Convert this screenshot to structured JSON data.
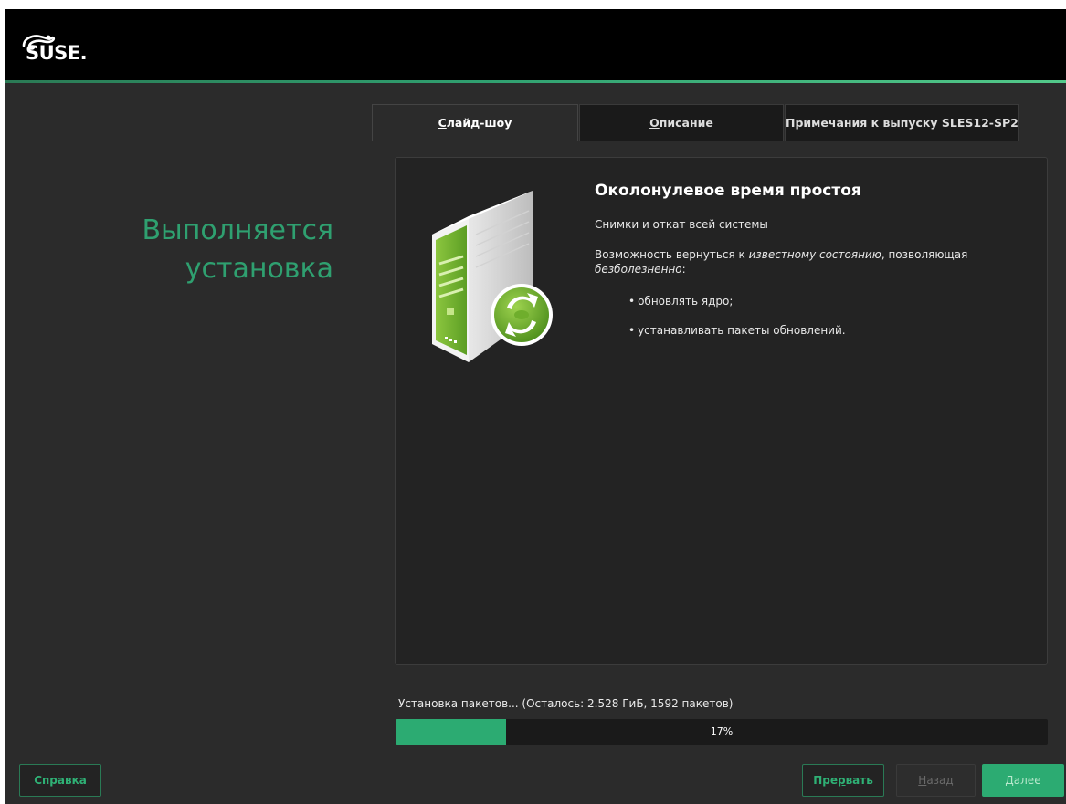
{
  "brand": {
    "logo_text": "SUSE.",
    "accent": "#2fa070",
    "progress_color": "#2cab72"
  },
  "heading": {
    "line1": "Выполняется",
    "line2": "установка"
  },
  "tabs": [
    {
      "label": "Слайд-шоу",
      "mnemonic": "С",
      "active": true
    },
    {
      "label": "Описание",
      "mnemonic": "О",
      "active": false
    },
    {
      "label": "Примечания к выпуску SLES12-SP2",
      "active": false
    }
  ],
  "slide": {
    "image_icon": "server-update-icon",
    "title": "Околонулевое время простоя",
    "subtitle": "Снимки и откат всей системы",
    "body_pre": "Возможность вернуться к ",
    "body_em1": "известному состоянию",
    "body_mid": ", позволяющая ",
    "body_em2": "безболезненно",
    "body_post": ":",
    "bullets": [
      "обновлять ядро;",
      "устанавливать пакеты обновлений."
    ]
  },
  "progress": {
    "label": "Установка пакетов... (Осталось: 2.528 ГиБ, 1592 пакетов)",
    "percent": 17,
    "percent_text": "17%"
  },
  "buttons": {
    "help": "Справка",
    "abort_pre": "Пре",
    "abort_mn": "р",
    "abort_post": "вать",
    "back_mn": "Н",
    "back_post": "азад",
    "next": "Далее"
  }
}
